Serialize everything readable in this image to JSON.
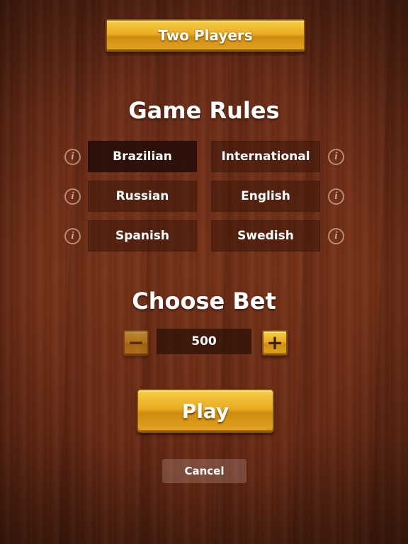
{
  "header": {
    "title": "Two Players"
  },
  "rules": {
    "heading": "Game Rules",
    "options": [
      {
        "label": "Brazilian",
        "selected": true
      },
      {
        "label": "International",
        "selected": false
      },
      {
        "label": "Russian",
        "selected": false
      },
      {
        "label": "English",
        "selected": false
      },
      {
        "label": "Spanish",
        "selected": false
      },
      {
        "label": "Swedish",
        "selected": false
      }
    ],
    "info_glyph": "i"
  },
  "bet": {
    "heading": "Choose Bet",
    "value": "500",
    "decrease_glyph": "−",
    "increase_glyph": "+"
  },
  "actions": {
    "play_label": "Play",
    "cancel_label": "Cancel"
  },
  "colors": {
    "gold": "#e9ac22",
    "wood": "#773319"
  }
}
